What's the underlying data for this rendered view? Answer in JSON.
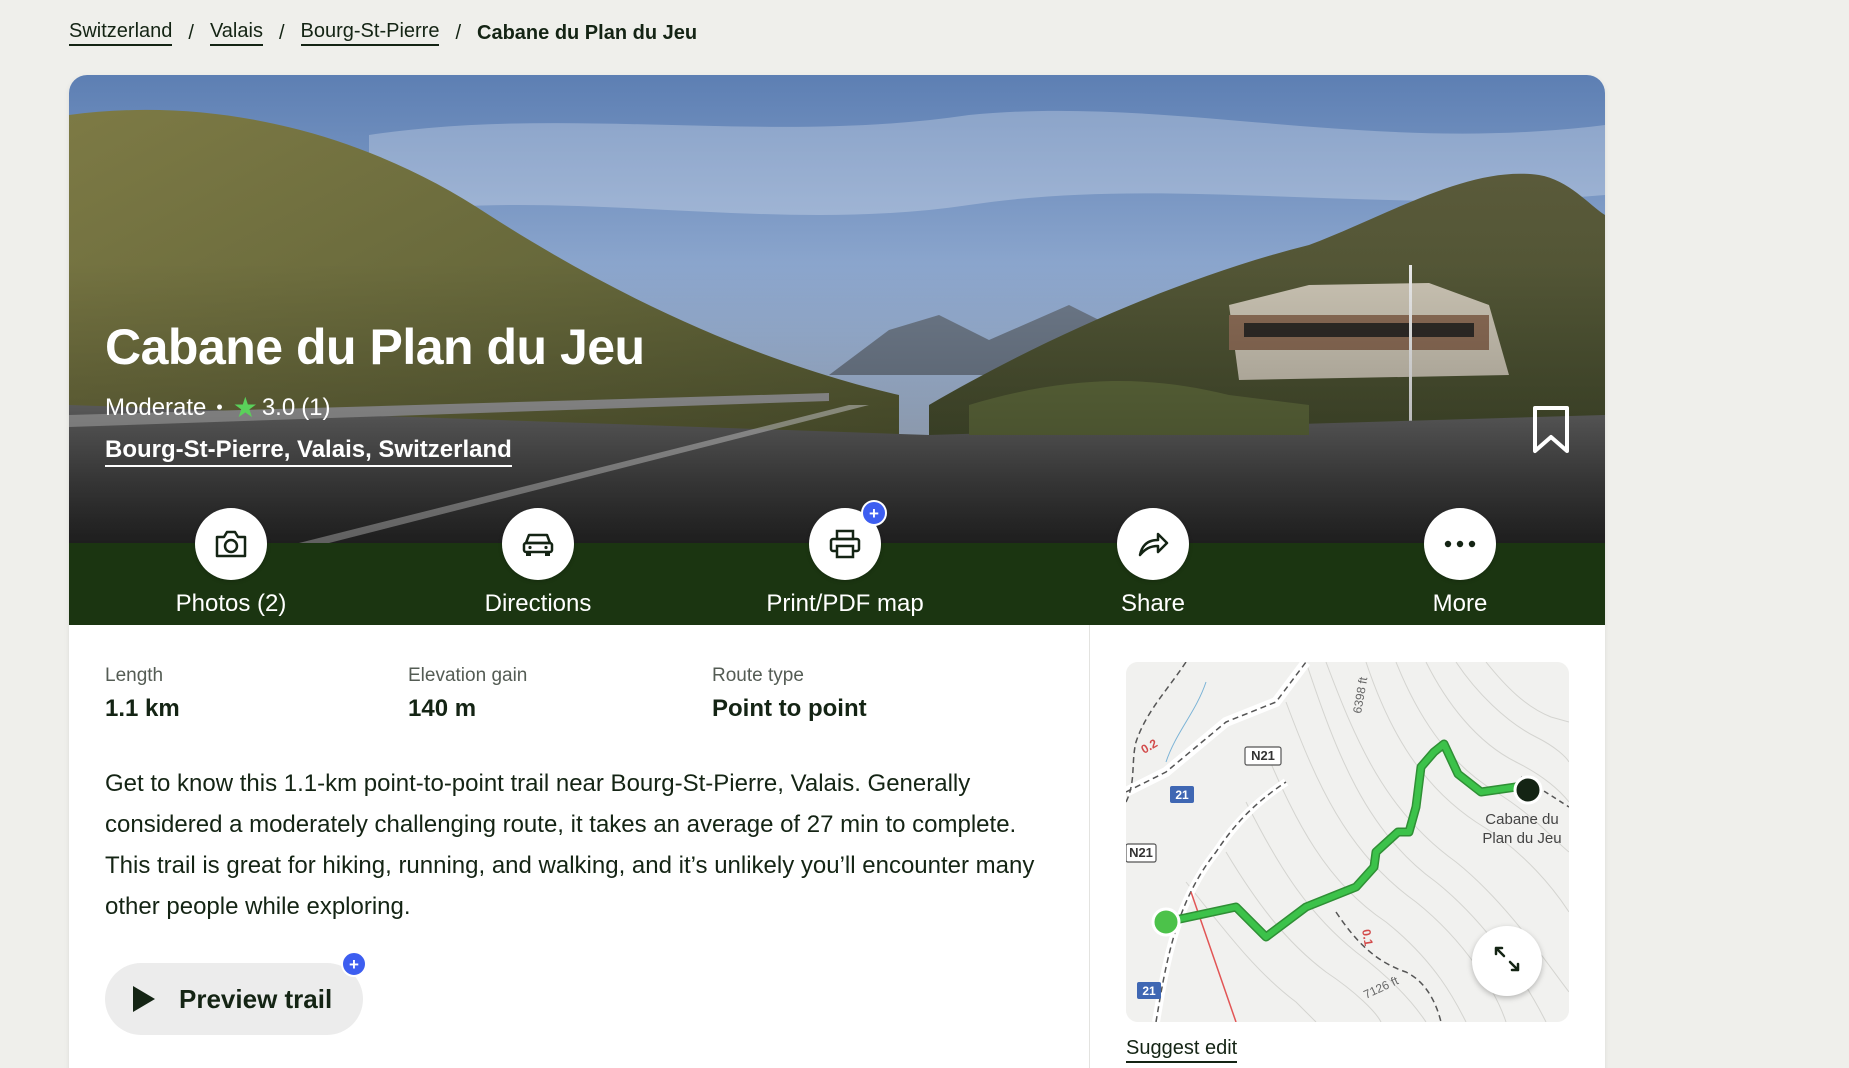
{
  "breadcrumb": {
    "items": [
      "Switzerland",
      "Valais",
      "Bourg-St-Pierre"
    ],
    "current": "Cabane du Plan du Jeu",
    "separator": "/"
  },
  "hero": {
    "title": "Cabane du Plan du Jeu",
    "difficulty": "Moderate",
    "rating": "3.0",
    "rating_count": "(1)",
    "location": "Bourg-St-Pierre, Valais, Switzerland",
    "bookmark_icon": "bookmark-icon"
  },
  "actions": [
    {
      "label": "Photos (2)",
      "icon": "camera-icon"
    },
    {
      "label": "Directions",
      "icon": "car-icon"
    },
    {
      "label": "Print/PDF map",
      "icon": "printer-icon",
      "badge": "+"
    },
    {
      "label": "Share",
      "icon": "share-icon"
    },
    {
      "label": "More",
      "icon": "more-icon"
    }
  ],
  "stats": [
    {
      "label": "Length",
      "value": "1.1 km"
    },
    {
      "label": "Elevation gain",
      "value": "140 m"
    },
    {
      "label": "Route type",
      "value": "Point to point"
    }
  ],
  "description": "Get to know this 1.1-km point-to-point trail near Bourg-St-Pierre, Valais. Generally considered a moderately challenging route, it takes an average of 27 min to complete. This trail is great for hiking, running, and walking, and it’s unlikely you’ll encounter many other people while exploring.",
  "preview": {
    "label": "Preview trail",
    "badge": "+"
  },
  "map": {
    "labels": {
      "road_n21_top": "N21",
      "road_n21_left": "N21",
      "road_21_a": "21",
      "road_21_b": "21",
      "contour_6398": "6398 ft",
      "contour_7126": "7126 ft",
      "distance_a": "0.2",
      "distance_b": "0.1",
      "destination_line1": "Cabane du",
      "destination_line2": "Plan du Jeu"
    },
    "colors": {
      "trail": "#3cc24a",
      "start": "#4cc24a",
      "end": "#142414"
    }
  },
  "suggest_edit": "Suggest edit",
  "colors": {
    "action_bar": "#1b3511",
    "page_bg": "#efefeb",
    "badge": "#3d5ef0",
    "star": "#5ad15a"
  }
}
